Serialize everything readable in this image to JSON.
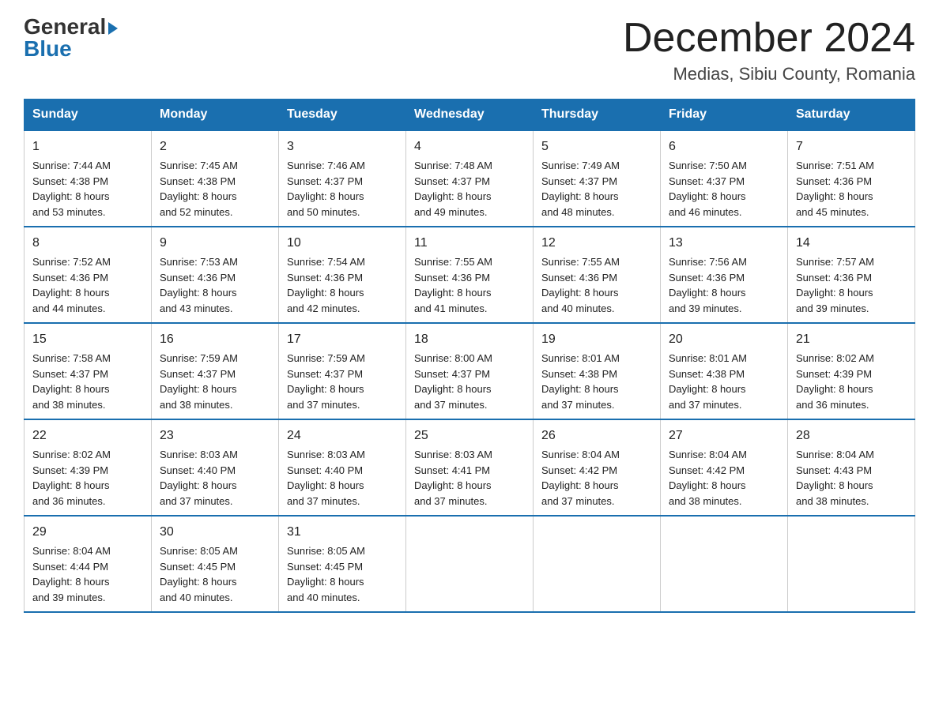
{
  "logo": {
    "general": "General",
    "blue": "Blue",
    "triangle": "▶"
  },
  "header": {
    "title": "December 2024",
    "subtitle": "Medias, Sibiu County, Romania"
  },
  "weekdays": [
    "Sunday",
    "Monday",
    "Tuesday",
    "Wednesday",
    "Thursday",
    "Friday",
    "Saturday"
  ],
  "weeks": [
    [
      {
        "day": "1",
        "sunrise": "7:44 AM",
        "sunset": "4:38 PM",
        "daylight": "8 hours and 53 minutes."
      },
      {
        "day": "2",
        "sunrise": "7:45 AM",
        "sunset": "4:38 PM",
        "daylight": "8 hours and 52 minutes."
      },
      {
        "day": "3",
        "sunrise": "7:46 AM",
        "sunset": "4:37 PM",
        "daylight": "8 hours and 50 minutes."
      },
      {
        "day": "4",
        "sunrise": "7:48 AM",
        "sunset": "4:37 PM",
        "daylight": "8 hours and 49 minutes."
      },
      {
        "day": "5",
        "sunrise": "7:49 AM",
        "sunset": "4:37 PM",
        "daylight": "8 hours and 48 minutes."
      },
      {
        "day": "6",
        "sunrise": "7:50 AM",
        "sunset": "4:37 PM",
        "daylight": "8 hours and 46 minutes."
      },
      {
        "day": "7",
        "sunrise": "7:51 AM",
        "sunset": "4:36 PM",
        "daylight": "8 hours and 45 minutes."
      }
    ],
    [
      {
        "day": "8",
        "sunrise": "7:52 AM",
        "sunset": "4:36 PM",
        "daylight": "8 hours and 44 minutes."
      },
      {
        "day": "9",
        "sunrise": "7:53 AM",
        "sunset": "4:36 PM",
        "daylight": "8 hours and 43 minutes."
      },
      {
        "day": "10",
        "sunrise": "7:54 AM",
        "sunset": "4:36 PM",
        "daylight": "8 hours and 42 minutes."
      },
      {
        "day": "11",
        "sunrise": "7:55 AM",
        "sunset": "4:36 PM",
        "daylight": "8 hours and 41 minutes."
      },
      {
        "day": "12",
        "sunrise": "7:55 AM",
        "sunset": "4:36 PM",
        "daylight": "8 hours and 40 minutes."
      },
      {
        "day": "13",
        "sunrise": "7:56 AM",
        "sunset": "4:36 PM",
        "daylight": "8 hours and 39 minutes."
      },
      {
        "day": "14",
        "sunrise": "7:57 AM",
        "sunset": "4:36 PM",
        "daylight": "8 hours and 39 minutes."
      }
    ],
    [
      {
        "day": "15",
        "sunrise": "7:58 AM",
        "sunset": "4:37 PM",
        "daylight": "8 hours and 38 minutes."
      },
      {
        "day": "16",
        "sunrise": "7:59 AM",
        "sunset": "4:37 PM",
        "daylight": "8 hours and 38 minutes."
      },
      {
        "day": "17",
        "sunrise": "7:59 AM",
        "sunset": "4:37 PM",
        "daylight": "8 hours and 37 minutes."
      },
      {
        "day": "18",
        "sunrise": "8:00 AM",
        "sunset": "4:37 PM",
        "daylight": "8 hours and 37 minutes."
      },
      {
        "day": "19",
        "sunrise": "8:01 AM",
        "sunset": "4:38 PM",
        "daylight": "8 hours and 37 minutes."
      },
      {
        "day": "20",
        "sunrise": "8:01 AM",
        "sunset": "4:38 PM",
        "daylight": "8 hours and 37 minutes."
      },
      {
        "day": "21",
        "sunrise": "8:02 AM",
        "sunset": "4:39 PM",
        "daylight": "8 hours and 36 minutes."
      }
    ],
    [
      {
        "day": "22",
        "sunrise": "8:02 AM",
        "sunset": "4:39 PM",
        "daylight": "8 hours and 36 minutes."
      },
      {
        "day": "23",
        "sunrise": "8:03 AM",
        "sunset": "4:40 PM",
        "daylight": "8 hours and 37 minutes."
      },
      {
        "day": "24",
        "sunrise": "8:03 AM",
        "sunset": "4:40 PM",
        "daylight": "8 hours and 37 minutes."
      },
      {
        "day": "25",
        "sunrise": "8:03 AM",
        "sunset": "4:41 PM",
        "daylight": "8 hours and 37 minutes."
      },
      {
        "day": "26",
        "sunrise": "8:04 AM",
        "sunset": "4:42 PM",
        "daylight": "8 hours and 37 minutes."
      },
      {
        "day": "27",
        "sunrise": "8:04 AM",
        "sunset": "4:42 PM",
        "daylight": "8 hours and 38 minutes."
      },
      {
        "day": "28",
        "sunrise": "8:04 AM",
        "sunset": "4:43 PM",
        "daylight": "8 hours and 38 minutes."
      }
    ],
    [
      {
        "day": "29",
        "sunrise": "8:04 AM",
        "sunset": "4:44 PM",
        "daylight": "8 hours and 39 minutes."
      },
      {
        "day": "30",
        "sunrise": "8:05 AM",
        "sunset": "4:45 PM",
        "daylight": "8 hours and 40 minutes."
      },
      {
        "day": "31",
        "sunrise": "8:05 AM",
        "sunset": "4:45 PM",
        "daylight": "8 hours and 40 minutes."
      },
      null,
      null,
      null,
      null
    ]
  ],
  "labels": {
    "sunrise": "Sunrise:",
    "sunset": "Sunset:",
    "daylight": "Daylight:"
  }
}
